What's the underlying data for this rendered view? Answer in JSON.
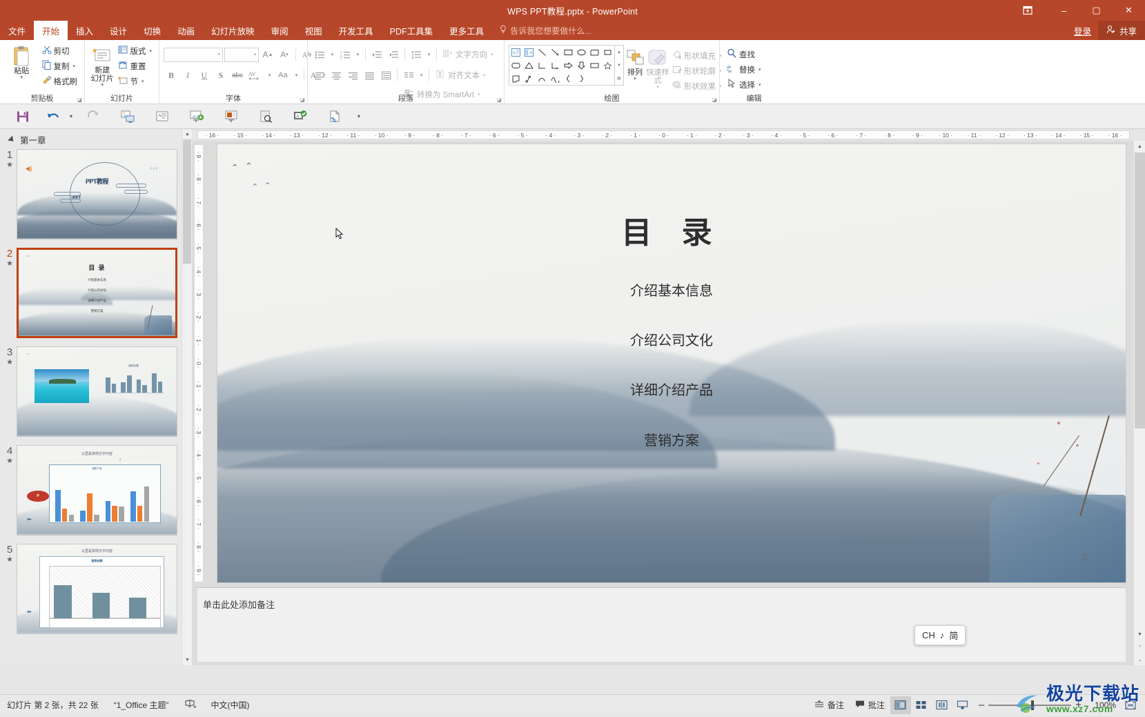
{
  "titlebar": {
    "title": "WPS PPT教程.pptx - PowerPoint",
    "ribbon_display_icon": "ribbon-display-options-icon",
    "minimize": "–",
    "maximize": "▢",
    "close": "✕"
  },
  "tabs": [
    {
      "label": "文件",
      "active": false
    },
    {
      "label": "开始",
      "active": true
    },
    {
      "label": "插入",
      "active": false
    },
    {
      "label": "设计",
      "active": false
    },
    {
      "label": "切换",
      "active": false
    },
    {
      "label": "动画",
      "active": false
    },
    {
      "label": "幻灯片放映",
      "active": false
    },
    {
      "label": "审阅",
      "active": false
    },
    {
      "label": "视图",
      "active": false
    },
    {
      "label": "开发工具",
      "active": false
    },
    {
      "label": "PDF工具集",
      "active": false
    },
    {
      "label": "更多工具",
      "active": false
    }
  ],
  "tellme": {
    "placeholder": "告诉我您想要做什么...",
    "icon": "lightbulb-icon"
  },
  "account": {
    "signin": "登录",
    "share": "共享",
    "share_icon": "person-add-icon"
  },
  "ribbon": {
    "groups": [
      {
        "name": "剪贴板",
        "big": {
          "label": "粘贴",
          "icon": "clipboard-icon",
          "caret": "▾"
        },
        "small": [
          {
            "label": "剪切",
            "icon": "scissors-icon",
            "caret": ""
          },
          {
            "label": "复制",
            "icon": "copy-icon",
            "caret": "▾"
          },
          {
            "label": "格式刷",
            "icon": "format-painter-icon",
            "caret": ""
          }
        ]
      },
      {
        "name": "幻灯片",
        "big": {
          "label": "新建\n幻灯片",
          "icon": "new-slide-icon",
          "caret": "▾"
        },
        "small": [
          {
            "label": "版式",
            "icon": "layout-icon",
            "caret": "▾"
          },
          {
            "label": "重置",
            "icon": "reset-icon",
            "caret": ""
          },
          {
            "label": "节",
            "icon": "section-icon",
            "caret": "▾"
          }
        ]
      },
      {
        "name": "字体",
        "font_name": "",
        "font_size": "",
        "buttons": [
          "增大字号 A▲",
          "减小字号 A▾",
          "清除格式",
          "B",
          "I",
          "U",
          "S",
          "abc",
          "AV 字符间距",
          "Aa 更改大小写",
          "A 字体颜色"
        ]
      },
      {
        "name": "段落",
        "buttons": [
          "项目符号",
          "编号",
          "减少缩进",
          "增加缩进",
          "行距",
          "左对齐",
          "居中",
          "右对齐",
          "两端对齐",
          "分栏",
          "文字方向",
          "对齐文本",
          "转换为 SmartArt"
        ],
        "labels": [
          "文字方向",
          "对齐文本",
          "转换为 SmartArt"
        ]
      },
      {
        "name": "绘图",
        "shapes": [
          "文本框",
          "竖排文本框",
          "直线",
          "箭头",
          "矩形",
          "椭圆",
          "圆角矩形",
          "三角形",
          "直角连接符",
          "肘形箭头",
          "右箭头",
          "下箭头",
          "云形",
          "剪切",
          "弧形",
          "曲线",
          "左大括号",
          "右大括号"
        ],
        "arrange": {
          "label": "排列",
          "caret": "▾"
        },
        "quickstyle": {
          "label": "快速样式",
          "caret": "▾"
        },
        "small": [
          {
            "label": "形状填充",
            "caret": "▾"
          },
          {
            "label": "形状轮廓",
            "caret": "▾"
          },
          {
            "label": "形状效果",
            "caret": "▾"
          }
        ]
      },
      {
        "name": "编辑",
        "small": [
          {
            "label": "查找",
            "icon": "search-icon",
            "caret": ""
          },
          {
            "label": "替换",
            "icon": "replace-icon",
            "caret": "▾"
          },
          {
            "label": "选择",
            "icon": "select-cursor-icon",
            "caret": "▾"
          }
        ]
      }
    ]
  },
  "qat": [
    {
      "name": "save-icon",
      "title": "保存"
    },
    {
      "name": "undo-icon",
      "title": "撤消"
    },
    {
      "name": "redo-icon",
      "title": "恢复"
    },
    {
      "name": "start-slideshow-icon",
      "title": "从头开始"
    },
    {
      "name": "outline-view-icon",
      "title": "大纲视图"
    },
    {
      "name": "present-current-icon",
      "title": "从当前幻灯片开始"
    },
    {
      "name": "custom-slideshow-icon",
      "title": "自定义放映"
    },
    {
      "name": "print-preview-icon",
      "title": "打印预览"
    },
    {
      "name": "spell-check-icon",
      "title": "拼写检查"
    },
    {
      "name": "hyperlink-icon",
      "title": "超链接"
    }
  ],
  "thumbnails": {
    "section_label": "第一章",
    "slides": [
      {
        "number": "1",
        "star": "★",
        "selected": false,
        "kind": "cover",
        "title": "PPT教程",
        "subtitle": "•PPT"
      },
      {
        "number": "2",
        "star": "★",
        "selected": true,
        "kind": "toc",
        "title": "目 录",
        "items": [
          "介绍基本信息",
          "介绍公司文化",
          "详细介绍产品",
          "营销方案"
        ]
      },
      {
        "number": "3",
        "star": "★",
        "selected": false,
        "kind": "photo-chart",
        "chart_title": "图表标题"
      },
      {
        "number": "4",
        "star": "★",
        "selected": false,
        "kind": "bar-chart",
        "heading": "以里是举例文字内容",
        "chart_title": "销售产量",
        "page": "3"
      },
      {
        "number": "5",
        "star": "★",
        "selected": false,
        "kind": "table-chart",
        "heading": "以里是举例文字内容",
        "chart_title": "图表标题"
      }
    ]
  },
  "ruler": {
    "horizontal": [
      "16",
      "15",
      "14",
      "13",
      "12",
      "11",
      "10",
      "9",
      "8",
      "7",
      "6",
      "5",
      "4",
      "3",
      "2",
      "1",
      "0",
      "1",
      "2",
      "3",
      "4",
      "5",
      "6",
      "7",
      "8",
      "9",
      "10",
      "11",
      "12",
      "13",
      "14",
      "15",
      "16"
    ],
    "vertical": [
      "9",
      "8",
      "7",
      "6",
      "5",
      "4",
      "3",
      "2",
      "1",
      "0",
      "1",
      "2",
      "3",
      "4",
      "5",
      "6",
      "7",
      "8",
      "9"
    ]
  },
  "slide": {
    "title": "目 录",
    "items": [
      "介绍基本信息",
      "介绍公司文化",
      "详细介绍产品",
      "营销方案"
    ],
    "page_number": "2"
  },
  "notes": {
    "placeholder": "单击此处添加备注"
  },
  "status": {
    "slide_info": "幻灯片 第 2 张，共 22 张",
    "theme": "“1_Office 主题”",
    "accessibility_icon": "accessibility-check-icon",
    "language": "中文(中国)",
    "notes_btn": "备注",
    "comments_btn": "批注",
    "views": [
      {
        "name": "normal-view-icon",
        "active": true
      },
      {
        "name": "slide-sorter-icon",
        "active": false
      },
      {
        "name": "reading-view-icon",
        "active": false
      },
      {
        "name": "slideshow-icon",
        "active": false
      }
    ],
    "zoom_out": "–",
    "zoom_in": "+",
    "zoom_value": "100%",
    "fit_icon": "fit-to-window-icon"
  },
  "ime": {
    "lang": "CH",
    "mode_icon": "♪",
    "shape": "简"
  },
  "watermark": {
    "brand": "极光下载站",
    "url": "www.xz7.com"
  },
  "colors": {
    "accent": "#b7472a",
    "share_bg": "#a23e23",
    "selection": "#c0400f",
    "ribbon_bg": "#ffffff",
    "chrome": "#e8e8e8",
    "slide_bg": "#f2f2ef"
  }
}
